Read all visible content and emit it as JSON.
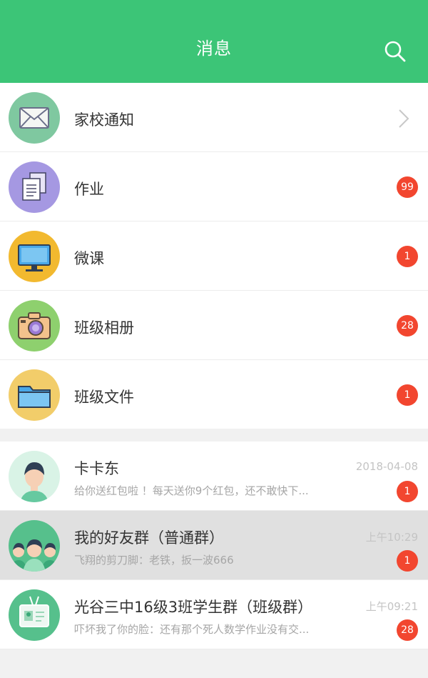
{
  "header": {
    "title": "消息",
    "search_icon": "search-icon"
  },
  "features": [
    {
      "label": "家校通知",
      "icon": "envelope-icon",
      "color": "#7fc8a0",
      "badge": null,
      "chevron": true
    },
    {
      "label": "作业",
      "icon": "documents-icon",
      "color": "#a598e2",
      "badge": "99"
    },
    {
      "label": "微课",
      "icon": "monitor-icon",
      "color": "#f2b92f",
      "badge": "1"
    },
    {
      "label": "班级相册",
      "icon": "camera-icon",
      "color": "#8ed06e",
      "badge": "28"
    },
    {
      "label": "班级文件",
      "icon": "folder-icon",
      "color": "#f2cd6a",
      "badge": "1"
    }
  ],
  "chats": [
    {
      "name": "卡卡东",
      "preview": "给你送红包啦 ！每天送你9个红包，还不敢快下...",
      "time": "2018-04-08",
      "badge": "1",
      "avatar": "person-avatar"
    },
    {
      "name": "我的好友群（普通群）",
      "preview": "飞翔的剪刀脚：老铁，扳一波666",
      "time": "上午10:29",
      "badge": "1",
      "avatar": "group-avatar"
    },
    {
      "name": "光谷三中16级3班学生群（班级群）",
      "preview": "吓坏我了你的脸：还有那个死人数学作业没有交...",
      "time": "上午09:21",
      "badge": "28",
      "avatar": "badge-avatar"
    }
  ]
}
